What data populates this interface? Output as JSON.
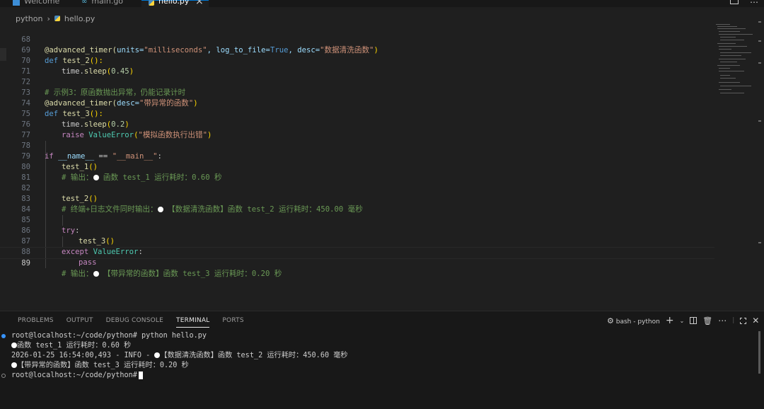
{
  "tabs": [
    {
      "label": "Welcome",
      "icon": "vscode-icon"
    },
    {
      "label": "main.go",
      "icon": "go-file-icon"
    },
    {
      "label": "hello.py",
      "icon": "python-file-icon",
      "active": true
    }
  ],
  "breadcrumb": {
    "folder": "python",
    "file": "hello.py"
  },
  "editor": {
    "current_line": "89",
    "lines": [
      {
        "n": "68",
        "t1": "@advanced_timer(",
        "t2": "units=",
        "t3": "\"milliseconds\"",
        "t4": ", log_to_file=",
        "t5": "True",
        "t6": ", desc=",
        "t7": "\"数据清洗函数\"",
        "t8": ")"
      },
      {
        "n": "69",
        "t1": "def ",
        "t2": "test_2",
        "t3": "():"
      },
      {
        "n": "70",
        "t1": "time.",
        "t2": "sleep",
        "t3": "(",
        "t4": "0.45",
        "t5": ")"
      },
      {
        "n": "71"
      },
      {
        "n": "72",
        "t1": "# 示例3：原函数抛出异常，仍能记录计时"
      },
      {
        "n": "73",
        "t1": "@advanced_timer(",
        "t2": "desc=",
        "t3": "\"带异常的函数\"",
        "t4": ")"
      },
      {
        "n": "74",
        "t1": "def ",
        "t2": "test_3",
        "t3": "():"
      },
      {
        "n": "75",
        "t1": "time.",
        "t2": "sleep",
        "t3": "(",
        "t4": "0.2",
        "t5": ")"
      },
      {
        "n": "76",
        "t1": "raise ",
        "t2": "ValueError",
        "t3": "(",
        "t4": "\"模拟函数执行出错\"",
        "t5": ")"
      },
      {
        "n": "77"
      },
      {
        "n": "78",
        "t1": "if ",
        "t2": "__name__",
        "t3": " == ",
        "t4": "\"__main__\"",
        "t5": ":"
      },
      {
        "n": "79",
        "t1": "test_1",
        "t2": "()"
      },
      {
        "n": "80",
        "t1": "# 输出：",
        "t2": " 函数 test_1 运行耗时：0.60 秒"
      },
      {
        "n": "81"
      },
      {
        "n": "82",
        "t1": "test_2",
        "t2": "()"
      },
      {
        "n": "83",
        "t1": "# 终端+日志文件同时输出：",
        "t2": " 【数据清洗函数】函数 test_2 运行耗时：450.00 毫秒"
      },
      {
        "n": "84"
      },
      {
        "n": "85",
        "t1": "try",
        "t2": ":"
      },
      {
        "n": "86",
        "t1": "test_3",
        "t2": "()"
      },
      {
        "n": "87",
        "t1": "except ",
        "t2": "ValueError",
        "t3": ":"
      },
      {
        "n": "88",
        "t1": "pass"
      },
      {
        "n": "89",
        "t1": "# 输出：",
        "t2": " 【带异常的函数】函数 test_3 运行耗时：0.20 秒"
      }
    ]
  },
  "panel": {
    "tabs": [
      "PROBLEMS",
      "OUTPUT",
      "DEBUG CONSOLE",
      "TERMINAL",
      "PORTS"
    ],
    "active_tab": "TERMINAL",
    "shell_label": "bash - python",
    "terminal": [
      "root@localhost:~/code/python# python hello.py",
      "函数 test_1 运行耗时：0.60 秒",
      "2026-01-25 16:54:00,493 - INFO - ",
      "【数据清洗函数】函数 test_2 运行耗时：450.60 毫秒",
      "【带异常的函数】函数 test_3 运行耗时：0.20 秒",
      "root@localhost:~/code/python#"
    ]
  }
}
